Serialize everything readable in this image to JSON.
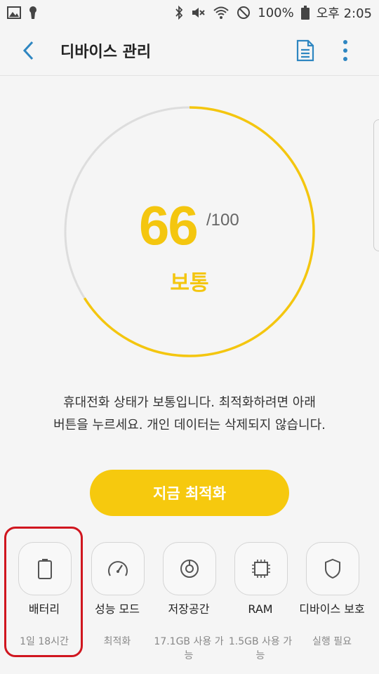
{
  "status_bar": {
    "battery_percent": "100%",
    "time": "오후 2:05"
  },
  "app_bar": {
    "title": "디바이스 관리"
  },
  "score": {
    "value": "66",
    "max": "/100",
    "status": "보통",
    "fraction": 0.66,
    "accent_color": "#f4c60f"
  },
  "description": {
    "line1": "휴대전화 상태가 보통입니다. 최적화하려면 아래",
    "line2": "버튼을 누르세요. 개인 데이터는 삭제되지 않습니다."
  },
  "optimize_button": {
    "label": "지금 최적화"
  },
  "tiles": [
    {
      "icon": "battery-icon",
      "label": "배터리",
      "sub": "1일 18시간"
    },
    {
      "icon": "speedometer-icon",
      "label": "성능 모드",
      "sub": "최적화"
    },
    {
      "icon": "storage-icon",
      "label": "저장공간",
      "sub": "17.1GB 사용 가능"
    },
    {
      "icon": "ram-chip-icon",
      "label": "RAM",
      "sub": "1.5GB 사용 가능"
    },
    {
      "icon": "shield-icon",
      "label": "디바이스 보호",
      "sub": "실행 필요"
    }
  ]
}
